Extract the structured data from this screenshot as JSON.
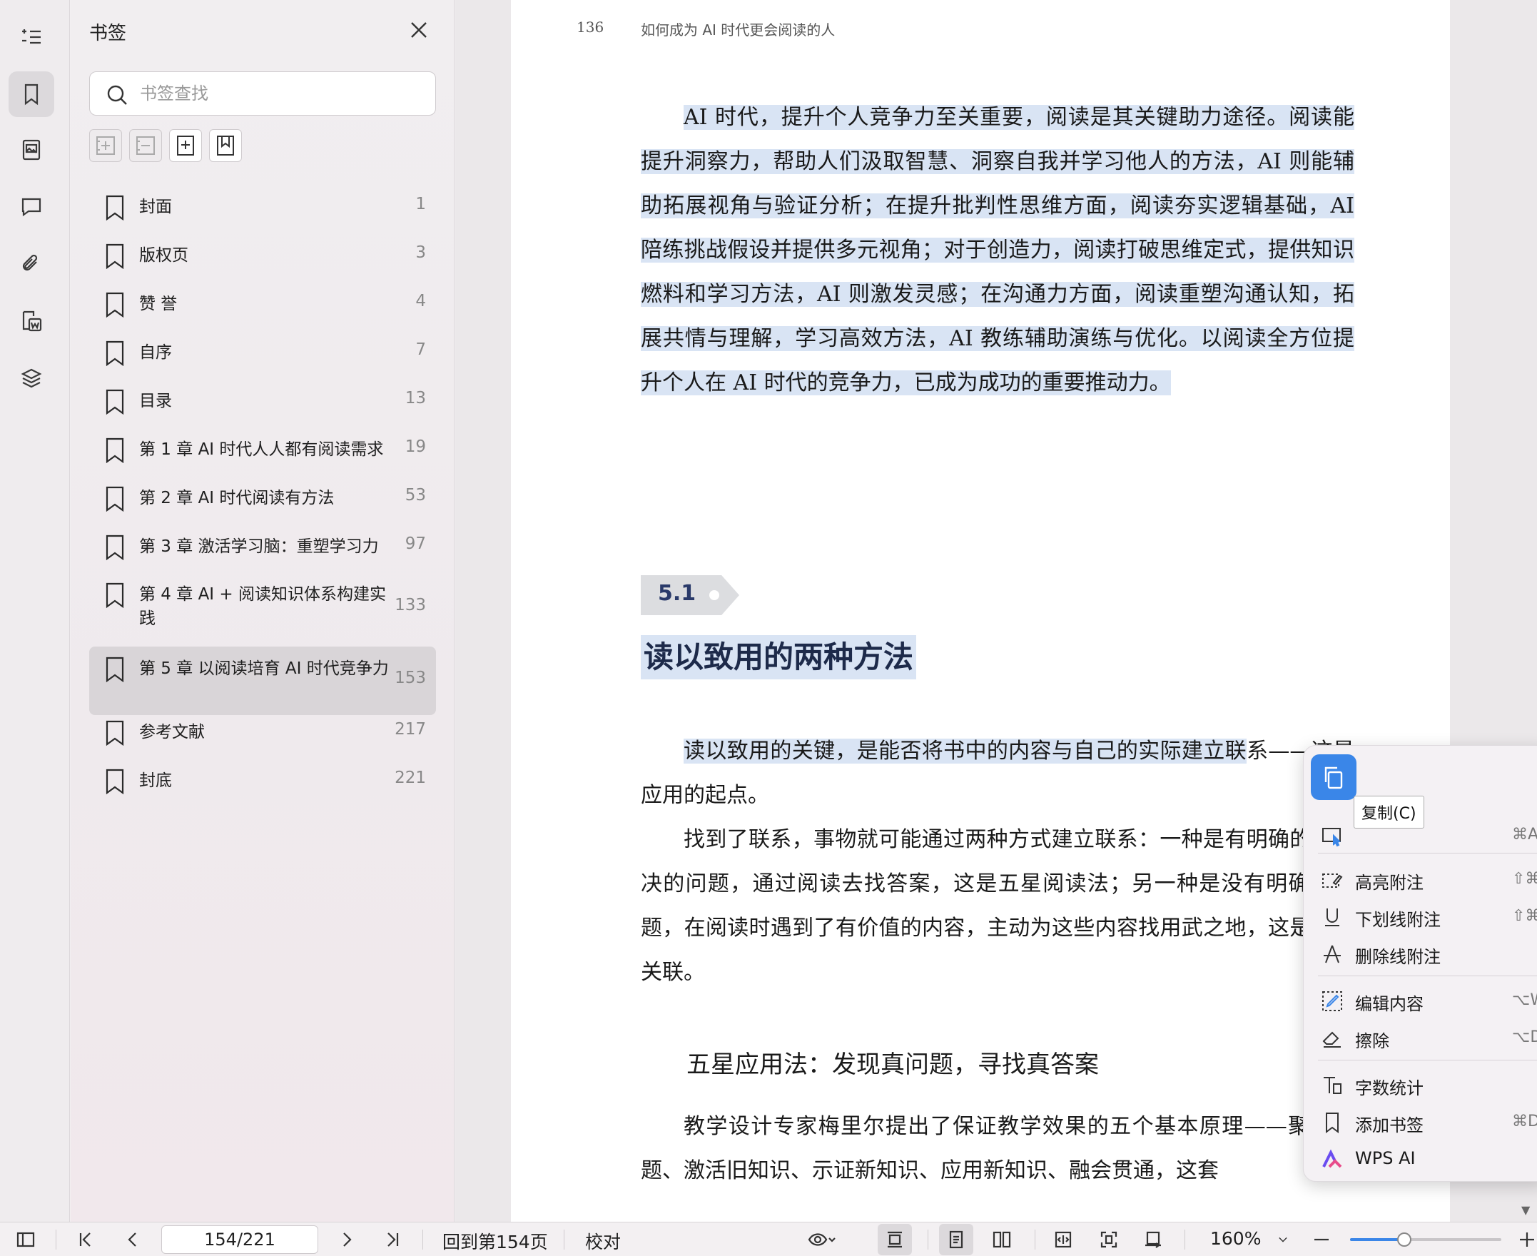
{
  "panel": {
    "title": "书签",
    "search_placeholder": "书签查找",
    "bookmarks": [
      {
        "label": "封面",
        "page": "1"
      },
      {
        "label": "版权页",
        "page": "3"
      },
      {
        "label": "赞 誉",
        "page": "4"
      },
      {
        "label": "自序",
        "page": "7"
      },
      {
        "label": "目录",
        "page": "13"
      },
      {
        "label": "第 1 章  AI 时代人人都有阅读需求",
        "page": "19"
      },
      {
        "label": "第 2 章  AI 时代阅读有方法",
        "page": "53"
      },
      {
        "label": "第 3 章  激活学习脑：重塑学习力",
        "page": "97"
      },
      {
        "label": "第 4 章  AI + 阅读知识体系构建实践",
        "page": "133"
      },
      {
        "label": "第 5 章  以阅读培育 AI 时代竞争力",
        "page": "153"
      },
      {
        "label": "参考文献",
        "page": "217"
      },
      {
        "label": "封底",
        "page": "221"
      }
    ]
  },
  "document": {
    "page_number": "136",
    "running_header": "如何成为 AI 时代更会阅读的人",
    "para1": "AI 时代，提升个人竞争力至关重要，阅读是其关键助力途径。阅读能提升洞察力，帮助人们汲取智慧、洞察自我并学习他人的方法，AI 则能辅助拓展视角与验证分析；在提升批判性思维方面，阅读夯实逻辑基础，AI 陪练挑战假设并提供多元视角；对于创造力，阅读打破思维定式，提供知识燃料和学习方法，AI 则激发灵感；在沟通力方面，阅读重塑沟通认知，拓展共情与理解，学习高效方法，AI 教练辅助演练与优化。以阅读全方位提升个人在 AI 时代的竞争力，已成为成功的重要推动力。",
    "section_number": "5.1",
    "section_title": "读以致用的两种方法",
    "para2_selected": "读以致用的关键，是能否将书中的内容与自己的实际建立联",
    "para2_rest": "系——这是应用的起点。",
    "para3": "找到了联系，事物就可能通过两种方式建立联系：一种是有明确的待解决的问题，通过阅读去找答案，这是五星阅读法；另一种是没有明确的问题，在阅读时遇到了有价值的内容，主动为这些内容找用武之地，这是野蛮关联。",
    "subsection_title": "五星应用法：发现真问题，寻找真答案",
    "para4": "教学设计专家梅里尔提出了保证教学效果的五个基本原理——聚焦问题、激活旧知识、示证新知识、应用新知识、融会贯通，这套"
  },
  "context_menu": {
    "tooltip": "复制(C)",
    "items": [
      {
        "label": "",
        "key": "⌘A"
      },
      {
        "label": "高亮附注",
        "key": "⇧⌘H"
      },
      {
        "label": "下划线附注",
        "key": "⇧⌘U"
      },
      {
        "label": "删除线附注",
        "key": ""
      },
      {
        "label": "编辑内容",
        "key": "⌥W"
      },
      {
        "label": "擦除",
        "key": "⌥D"
      },
      {
        "label": "字数统计",
        "key": ""
      },
      {
        "label": "添加书签",
        "key": "⌘D"
      },
      {
        "label": "WPS AI",
        "key": ""
      }
    ]
  },
  "statusbar": {
    "page_value": "154/221",
    "goto_label": "回到第154页",
    "proof_label": "校对",
    "zoom_label": "160%",
    "zoom_fraction": 0.36
  },
  "colors": {
    "accent": "#3a86e8",
    "selection": "#d9e4f4"
  }
}
